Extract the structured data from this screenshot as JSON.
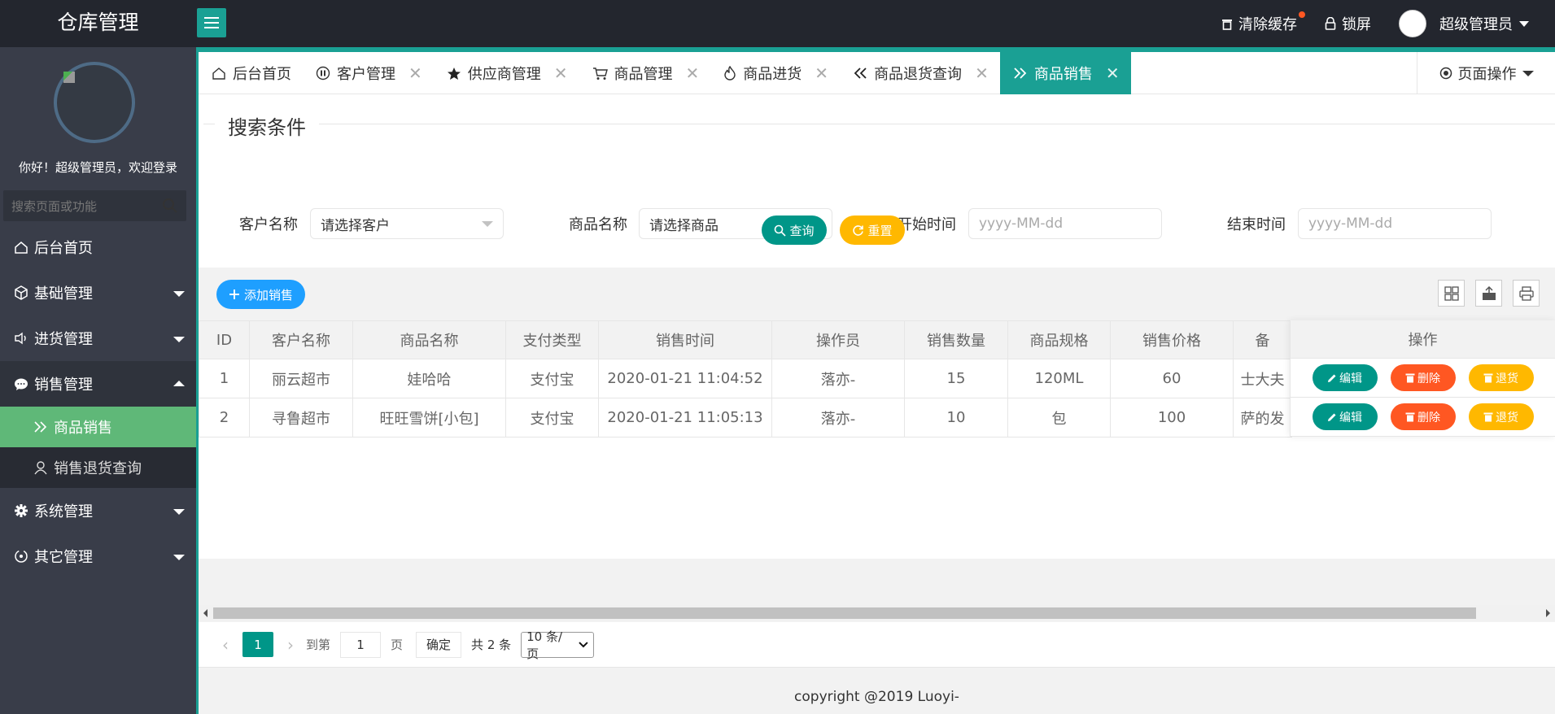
{
  "app": {
    "logo": "仓库管理"
  },
  "header": {
    "clear_cache": "清除缓存",
    "lock": "锁屏",
    "user": "超级管理员"
  },
  "sidebar": {
    "welcome": "你好！超级管理员，欢迎登录",
    "search_placeholder": "搜索页面或功能",
    "items": [
      {
        "label": "后台首页",
        "icon": "home-icon"
      },
      {
        "label": "基础管理",
        "icon": "cube-icon"
      },
      {
        "label": "进货管理",
        "icon": "volume-icon"
      },
      {
        "label": "销售管理",
        "icon": "chat-icon"
      },
      {
        "label": "系统管理",
        "icon": "gear-icon"
      },
      {
        "label": "其它管理",
        "icon": "circle-icon"
      }
    ],
    "sub_items": [
      {
        "label": "商品销售",
        "icon": "double-chevron-right-icon"
      },
      {
        "label": "销售退货查询",
        "icon": "user-icon"
      }
    ]
  },
  "tabs": [
    {
      "label": "后台首页",
      "icon": "home-icon"
    },
    {
      "label": "客户管理",
      "icon": "pause-icon"
    },
    {
      "label": "供应商管理",
      "icon": "star-icon"
    },
    {
      "label": "商品管理",
      "icon": "cart-icon"
    },
    {
      "label": "商品进货",
      "icon": "fire-icon"
    },
    {
      "label": "商品退货查询",
      "icon": "double-chevron-left-icon"
    },
    {
      "label": "商品销售",
      "icon": "double-chevron-right-icon"
    }
  ],
  "page_op": "页面操作",
  "search": {
    "title": "搜索条件",
    "customer_label": "客户名称",
    "customer_value": "请选择客户",
    "goods_label": "商品名称",
    "goods_value": "请选择商品",
    "start_label": "开始时间",
    "start_placeholder": "yyyy-MM-dd",
    "end_label": "结束时间",
    "end_placeholder": "yyyy-MM-dd",
    "query_btn": "查询",
    "reset_btn": "重置"
  },
  "toolbar": {
    "add_btn": "添加销售"
  },
  "table": {
    "columns": [
      "ID",
      "客户名称",
      "商品名称",
      "支付类型",
      "销售时间",
      "操作员",
      "销售数量",
      "商品规格",
      "销售价格",
      "备"
    ],
    "op_header": "操作",
    "rows": [
      [
        "1",
        "丽云超市",
        "娃哈哈",
        "支付宝",
        "2020-01-21 11:04:52",
        "落亦-",
        "15",
        "120ML",
        "60",
        "士大夫"
      ],
      [
        "2",
        "寻鲁超市",
        "旺旺雪饼[小包]",
        "支付宝",
        "2020-01-21 11:05:13",
        "落亦-",
        "10",
        "包",
        "100",
        "萨的发"
      ]
    ],
    "row_buttons": {
      "edit": "编辑",
      "delete": "删除",
      "return": "退货"
    }
  },
  "pager": {
    "current": "1",
    "goto_prefix": "到第",
    "goto_value": "1",
    "goto_suffix": "页",
    "confirm": "确定",
    "total": "共 2 条",
    "per_page": "10 条/页"
  },
  "footer": "copyright @2019 Luoyi-",
  "colors": {
    "primary": "#009688",
    "accent": "#1aa094",
    "danger": "#ff5722",
    "warn": "#ffb800",
    "blue": "#1e9fff",
    "active_nav": "#5fb878"
  }
}
